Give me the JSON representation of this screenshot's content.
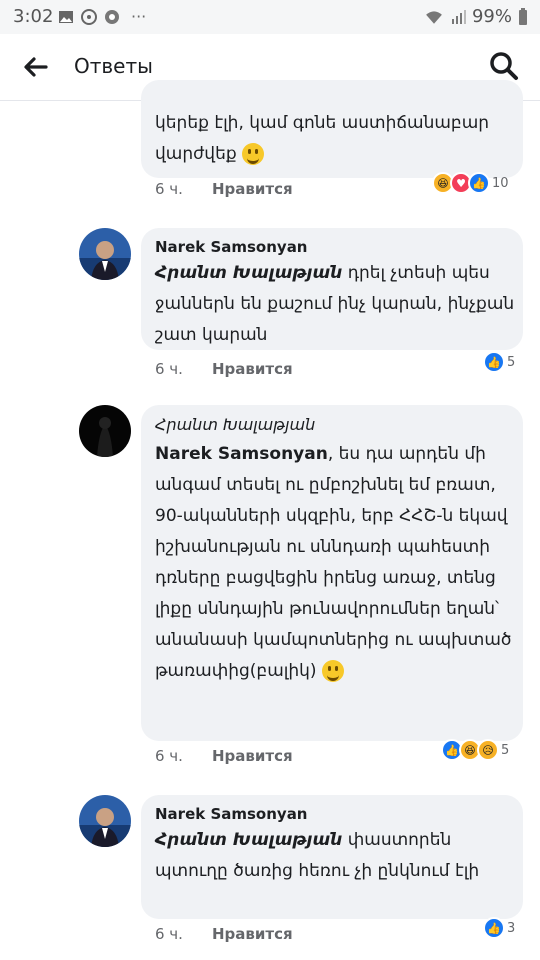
{
  "status": {
    "time": "3:02",
    "more": "···",
    "battery": "99%"
  },
  "header": {
    "title": "Ответы"
  },
  "comments": [
    {
      "text": "կերեք էլի, կամ գոնե աստիճանաբար վարժվեք",
      "partial_top": "․․․",
      "time": "6 ч.",
      "like_label": "Нравится",
      "reaction_count": "10"
    },
    {
      "author": "Narek Samsonyan",
      "mention": "Հրանտ Խալաթյան",
      "text": "դրել չտեսի պես ջաններն են քաշում ինչ կարան, ինչքան շատ կարան",
      "time": "6 ч.",
      "like_label": "Нравится",
      "reaction_count": "5"
    },
    {
      "author": "Հրանտ Խալաթյան",
      "mention": "Narek Samsonyan",
      "text": ", ես դա արդեն մի անգամ տեսել ու ըմբոշխնել եմ բռատ, 90-ականների սկզբին, երբ ՀՀՇ-ն եկավ իշխանության ու սննդառի պահեստի դռները բացվեցին իրենց առաջ, տենց լիքը սննդային թունավորումներ եղան՝ անանասի կամպոտներից ու ապխտած թառափից(բալիկ)",
      "time": "6 ч.",
      "like_label": "Нравится",
      "reaction_count": "5"
    },
    {
      "author": "Narek Samsonyan",
      "mention": "Հրանտ Խալաթյան",
      "text": "փաստորեն պտուղը ծառից հեռու չի ընկնում էլի",
      "time": "6 ч.",
      "like_label": "Нравится",
      "reaction_count": "3"
    }
  ]
}
